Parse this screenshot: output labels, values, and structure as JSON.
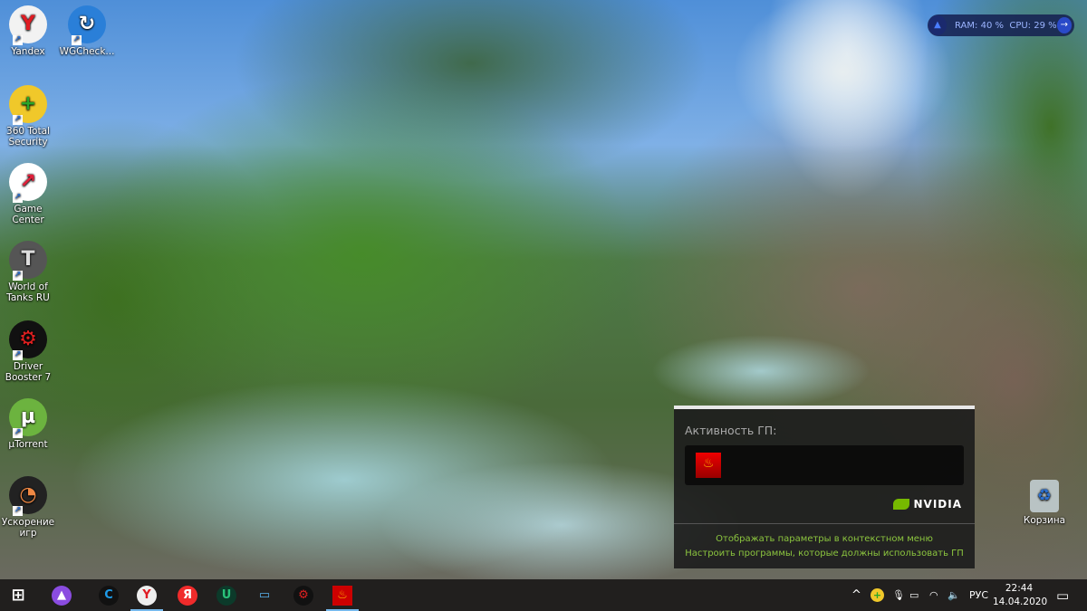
{
  "desktop": {
    "icons": [
      {
        "label": "Yandex",
        "glyph": "Y",
        "bg": "#f2f2f2",
        "fg": "#e01b22"
      },
      {
        "label": "WGCheck...",
        "glyph": "↻",
        "bg": "#2a7fd8",
        "fg": "#fff"
      },
      {
        "label": "360 Total Security",
        "glyph": "+",
        "bg": "#f0c82a",
        "fg": "#2aa52a"
      },
      {
        "label": "Game Center",
        "glyph": "↗",
        "bg": "#fff",
        "fg": "#e0203a"
      },
      {
        "label": "World of Tanks RU",
        "glyph": "T",
        "bg": "#555",
        "fg": "#ddd"
      },
      {
        "label": "Driver Booster 7",
        "glyph": "⚙",
        "bg": "#111",
        "fg": "#e02020"
      },
      {
        "label": "µTorrent",
        "glyph": "µ",
        "bg": "#6cb33f",
        "fg": "#fff"
      },
      {
        "label": "Ускорение игр",
        "glyph": "◔",
        "bg": "#222",
        "fg": "#e84"
      }
    ],
    "recycle_bin": "Корзина"
  },
  "monitor": {
    "text": "RAM: 40 %  CPU: 29 %",
    "icon": "rocket-icon",
    "arrow": "→"
  },
  "gpu_popup": {
    "title": "Активность ГП:",
    "app_icon": "FurMark",
    "brand": "NVIDIA",
    "links": [
      "Отображать параметры в контекстном меню",
      "Настроить программы, которые должны использовать ГП"
    ]
  },
  "taskbar": {
    "apps": [
      {
        "name": "start",
        "glyph": "⊞",
        "bg": "transparent",
        "fg": "#fff"
      },
      {
        "name": "alice",
        "glyph": "▲",
        "bg": "#8a4ce0",
        "fg": "#fff"
      },
      {
        "name": "ccleaner",
        "glyph": "C",
        "bg": "#111",
        "fg": "#1e9be8"
      },
      {
        "name": "yandex-browser",
        "glyph": "Y",
        "bg": "#eee",
        "fg": "#e01b22",
        "active": true
      },
      {
        "name": "yandex",
        "glyph": "Я",
        "bg": "#f02b2b",
        "fg": "#fff"
      },
      {
        "name": "iobit-uninstaller",
        "glyph": "U",
        "bg": "#0c3a2a",
        "fg": "#29c27a"
      },
      {
        "name": "this-pc",
        "glyph": "▭",
        "bg": "transparent",
        "fg": "#5ab4f0"
      },
      {
        "name": "driver-booster",
        "glyph": "⚙",
        "bg": "#111",
        "fg": "#e02020"
      },
      {
        "name": "furmark",
        "glyph": "♨",
        "bg": "#c00",
        "fg": "#ffb000",
        "active": true
      }
    ],
    "tray": {
      "chevron": "^",
      "lang": "РУС",
      "time": "22:44",
      "date": "14.04.2020"
    }
  }
}
